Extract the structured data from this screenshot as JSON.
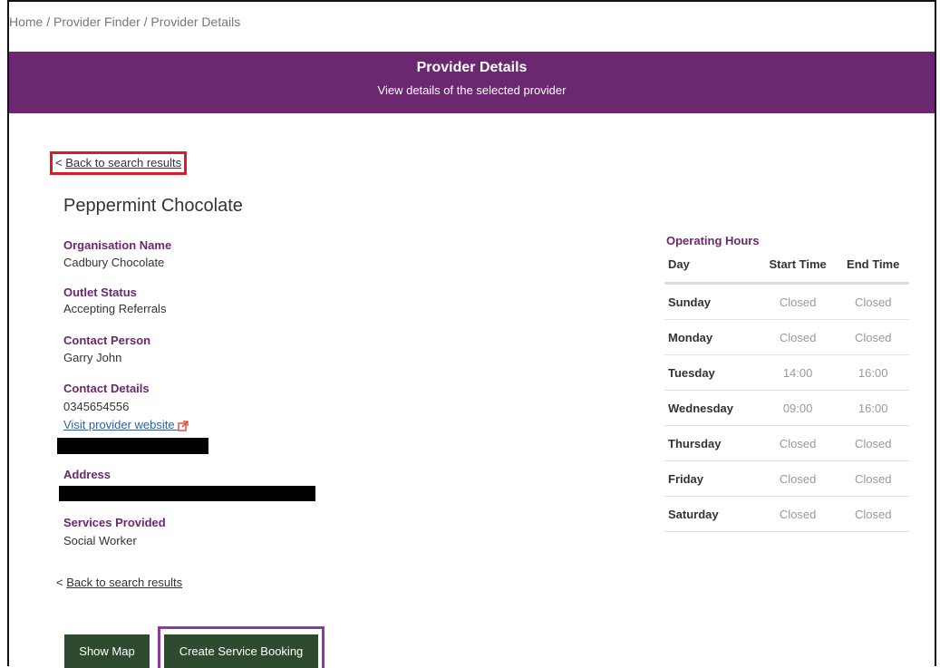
{
  "breadcrumb": {
    "home": "Home",
    "sep": "/",
    "finder": "Provider Finder",
    "current": "Provider Details"
  },
  "banner": {
    "title": "Provider Details",
    "subtitle": "View details of the selected provider"
  },
  "back_link": {
    "prefix": "<",
    "label": "Back to search results"
  },
  "provider": {
    "name": "Peppermint Chocolate",
    "organisation_label": "Organisation Name",
    "organisation_value": "Cadbury Chocolate",
    "status_label": "Outlet Status",
    "status_value": "Accepting Referrals",
    "contact_person_label": "Contact Person",
    "contact_person_value": "Garry John",
    "contact_details_label": "Contact Details",
    "contact_phone": "0345654556",
    "website_label": "Visit provider website",
    "address_label": "Address",
    "services_label": "Services Provided",
    "services_value": "Social Worker"
  },
  "operating_hours": {
    "title": "Operating Hours",
    "columns": [
      "Day",
      "Start Time",
      "End Time"
    ],
    "rows": [
      {
        "day": "Sunday",
        "start": "Closed",
        "end": "Closed"
      },
      {
        "day": "Monday",
        "start": "Closed",
        "end": "Closed"
      },
      {
        "day": "Tuesday",
        "start": "14:00",
        "end": "16:00"
      },
      {
        "day": "Wednesday",
        "start": "09:00",
        "end": "16:00"
      },
      {
        "day": "Thursday",
        "start": "Closed",
        "end": "Closed"
      },
      {
        "day": "Friday",
        "start": "Closed",
        "end": "Closed"
      },
      {
        "day": "Saturday",
        "start": "Closed",
        "end": "Closed"
      }
    ]
  },
  "buttons": {
    "show_map": "Show Map",
    "create_booking": "Create Service Booking"
  },
  "colors": {
    "brand_purple": "#6b2770",
    "button_green": "#2e4a2f",
    "highlight_red": "#d41f2a",
    "highlight_purple": "#8a3ba0"
  },
  "icons": {
    "external_link": "external-link-icon"
  }
}
